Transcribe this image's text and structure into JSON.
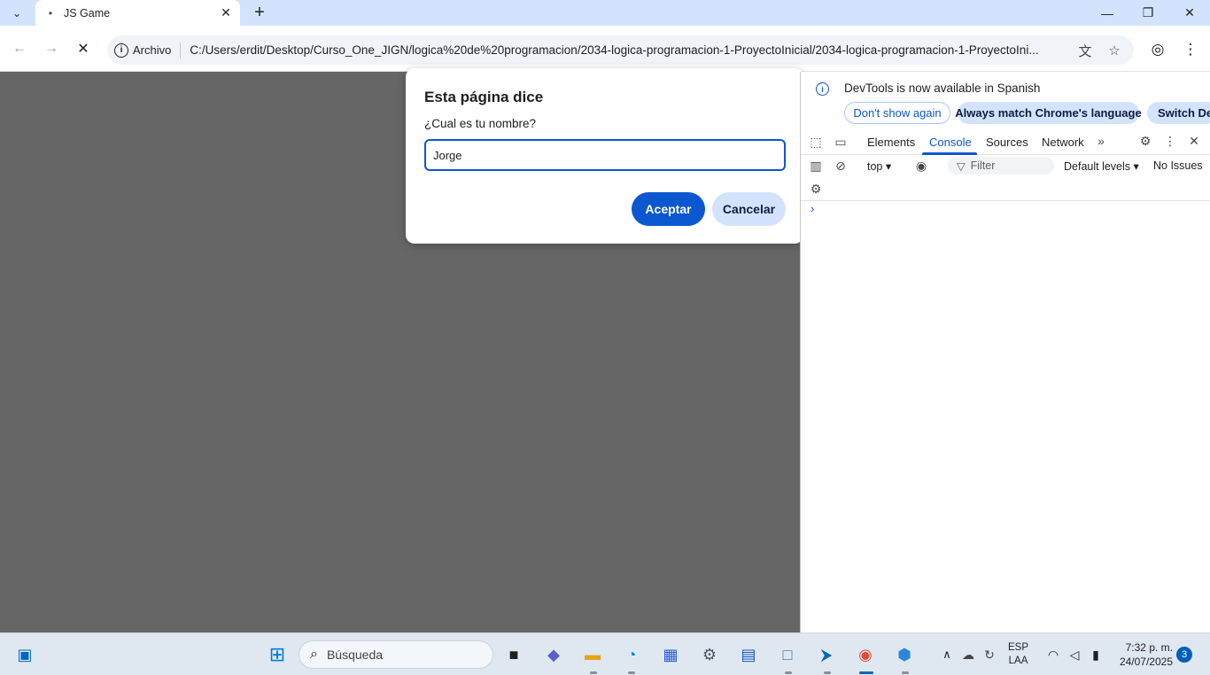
{
  "browser": {
    "tab_title": "JS Game",
    "omnibox": {
      "scheme_label": "Archivo",
      "url": "C:/Users/erdit/Desktop/Curso_One_JIGN/logica%20de%20programacion/2034-logica-programacion-1-ProyectoInicial/2034-logica-programacion-1-ProyectoIni..."
    }
  },
  "dialog": {
    "title": "Esta página dice",
    "message": "¿Cual es tu nombre?",
    "input_value": "Jorge",
    "accept_label": "Aceptar",
    "cancel_label": "Cancelar"
  },
  "devtools": {
    "infobar": {
      "text": "DevTools is now available in Spanish",
      "dont_show": "Don't show again",
      "always_match": "Always match Chrome's language",
      "switch": "Switch Dev"
    },
    "tabs": [
      "Elements",
      "Console",
      "Sources",
      "Network"
    ],
    "active_tab": "Console",
    "console": {
      "context": "top",
      "filter_placeholder": "Filter",
      "levels": "Default levels",
      "issues": "No Issues"
    }
  },
  "taskbar": {
    "search_placeholder": "Búsqueda",
    "lang_top": "ESP",
    "lang_bottom": "LAA",
    "time": "7:32 p. m.",
    "date": "24/07/2025",
    "notification_count": "3"
  },
  "colors": {
    "accent": "#0b57d0",
    "page_bg": "#666666",
    "tabstrip_bg": "#d3e3fd"
  }
}
